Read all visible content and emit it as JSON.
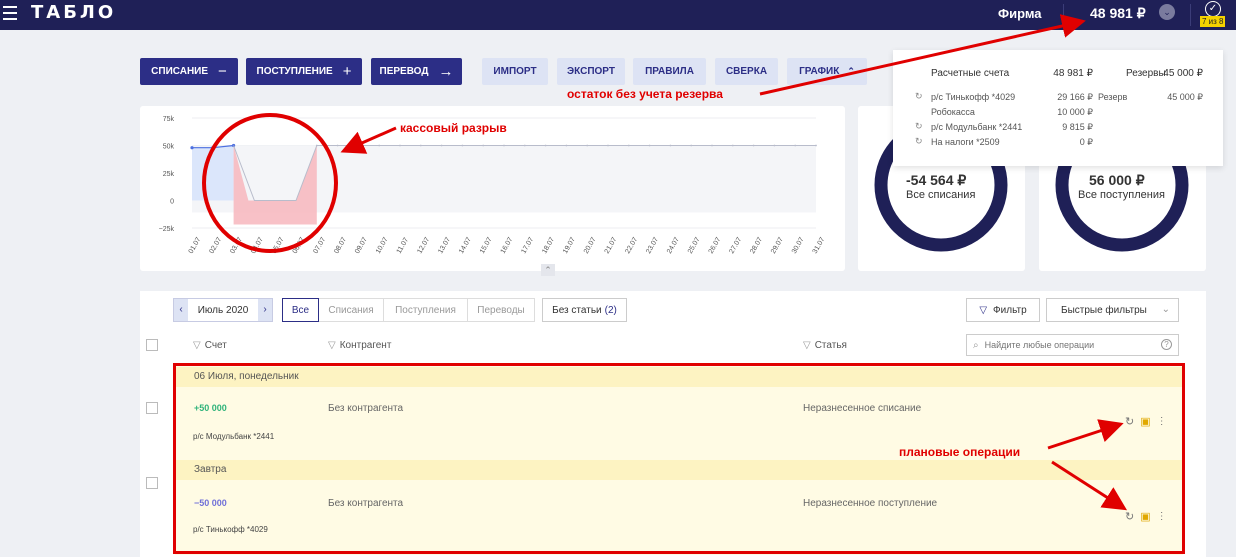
{
  "header": {
    "logo": "ТАБЛО",
    "company": "Фирма",
    "balance": "48 981 ₽",
    "tasks_badge": "7 из 8"
  },
  "actions": {
    "writeoff": "СПИСАНИЕ",
    "income": "ПОСТУПЛЕНИЕ",
    "transfer": "ПЕРЕВОД",
    "import": "ИМПОРТ",
    "export": "ЭКСПОРТ",
    "rules": "ПРАВИЛА",
    "reconcile": "СВЕРКА",
    "graph": "ГРАФИК"
  },
  "chart_data": {
    "type": "line",
    "y_ticks": [
      "75k",
      "50k",
      "25k",
      "0",
      "−25k"
    ],
    "x_ticks": [
      "01.07",
      "02.07",
      "03.07",
      "04.07",
      "05.07",
      "06.07",
      "07.07",
      "08.07",
      "09.07",
      "10.07",
      "11.07",
      "12.07",
      "13.07",
      "14.07",
      "15.07",
      "16.07",
      "17.07",
      "18.07",
      "19.07",
      "20.07",
      "21.07",
      "22.07",
      "23.07",
      "24.07",
      "25.07",
      "26.07",
      "27.07",
      "28.07",
      "29.07",
      "30.07",
      "31.07"
    ],
    "ylim": [
      -25000,
      75000
    ],
    "series": [
      {
        "role": "actual",
        "x": [
          "01.07",
          "02.07",
          "03.07"
        ],
        "y": [
          48000,
          48000,
          50000
        ]
      },
      {
        "role": "planned",
        "x": [
          "04.07",
          "05.07",
          "06.07",
          "07.07",
          "08.07",
          "09.07",
          "10.07",
          "11.07",
          "12.07",
          "13.07",
          "14.07",
          "15.07",
          "16.07",
          "17.07",
          "18.07",
          "19.07",
          "20.07",
          "21.07",
          "22.07",
          "23.07",
          "24.07",
          "25.07",
          "26.07",
          "27.07",
          "28.07",
          "29.07",
          "30.07",
          "31.07"
        ],
        "y": [
          0,
          0,
          0,
          50000,
          50000,
          50000,
          50000,
          50000,
          50000,
          50000,
          50000,
          50000,
          50000,
          50000,
          50000,
          50000,
          50000,
          50000,
          50000,
          50000,
          50000,
          50000,
          50000,
          50000,
          50000,
          50000,
          50000,
          50000
        ]
      }
    ],
    "grid": true
  },
  "donuts": {
    "writeoffs_value": "-54 564 ₽",
    "writeoffs_caption": "Все списания",
    "incomes_value": "56 000 ₽",
    "incomes_caption": "Все поступления",
    "ring_color": "#1f2057"
  },
  "balance_popup": {
    "accounts_label": "Расчетные счета",
    "accounts_total": "48 981 ₽",
    "reserves_label": "Резервы",
    "reserves_total": "45 000 ₽",
    "accounts": [
      {
        "name": "р/с Тинькофф *4029",
        "amount": "29 166 ₽"
      },
      {
        "name": "Робокасса",
        "amount": "10 000 ₽"
      },
      {
        "name": "р/с Модульбанк *2441",
        "amount": "9 815 ₽"
      },
      {
        "name": "На налоги *2509",
        "amount": "0 ₽"
      }
    ],
    "reserves": [
      {
        "name": "Резерв",
        "amount": "45 000 ₽"
      }
    ]
  },
  "ops": {
    "month": "Июль 2020",
    "tabs": [
      "Все",
      "Списания",
      "Поступления",
      "Переводы"
    ],
    "no_article": "Без статьи",
    "no_article_count": "(2)",
    "filter": "Фильтр",
    "quick_filters": "Быстрые фильтры",
    "columns": {
      "account": "Счет",
      "counterparty": "Контрагент",
      "article": "Статья"
    },
    "search_placeholder": "Найдите любые операции",
    "groups": [
      {
        "date": "06 Июля, понедельник",
        "amount": "+50 000",
        "amount_color": "#2fb37a",
        "account": "р/с Модульбанк *2441",
        "counterparty": "Без контрагента",
        "article": "Неразнесенное списание"
      },
      {
        "date": "Завтра",
        "amount": "−50 000",
        "amount_color": "#6f6fd8",
        "account": "р/с Тинькофф *4029",
        "counterparty": "Без контрагента",
        "article": "Неразнесенное поступление"
      }
    ]
  },
  "annotations": {
    "balance_note": "остаток без учета резерва",
    "cash_gap": "кассовый разрыв",
    "planned_ops": "плановые операции",
    "color": "#e00000"
  }
}
